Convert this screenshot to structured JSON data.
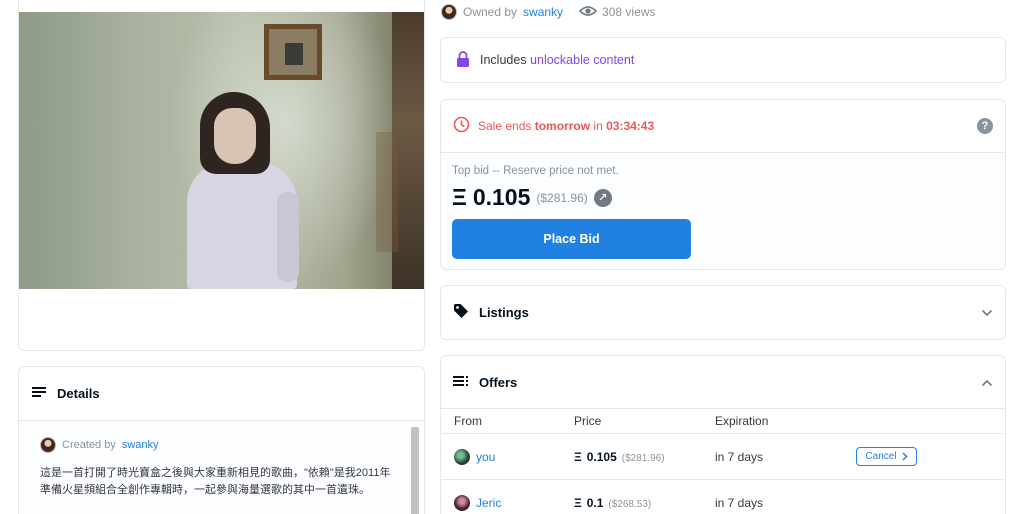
{
  "owner": {
    "prefix": "Owned by",
    "name": "swanky",
    "views": "308 views"
  },
  "unlockable": {
    "prefix": "Includes",
    "link": "unlockable content"
  },
  "sale": {
    "prefix": "Sale ends",
    "when": "tomorrow",
    "mid": "in",
    "countdown": "03:34:43",
    "help": "?",
    "top_bid_label": "Top bid -- Reserve price not met.",
    "eth_symbol": "Ξ",
    "price": "0.105",
    "price_usd": "($281.96)",
    "place_bid_label": "Place Bid"
  },
  "listings": {
    "title": "Listings"
  },
  "details": {
    "title": "Details",
    "created_prefix": "Created by",
    "creator": "swanky",
    "description": "這是一首打開了時光寶盒之後與大家重新相見的歌曲，\"依賴\"是我2011年準備火星頻組合全創作專輯時，一起參與海量選歌的其中一首遺珠。"
  },
  "offers": {
    "title": "Offers",
    "columns": [
      "From",
      "Price",
      "Expiration"
    ],
    "rows": [
      {
        "from": "you",
        "eth": "Ξ",
        "price": "0.105",
        "usd": "($281.96)",
        "expiration": "in 7 days",
        "action": "Cancel"
      },
      {
        "from": "Jeric",
        "eth": "Ξ",
        "price": "0.1",
        "usd": "($268.53)",
        "expiration": "in 7 days",
        "action": ""
      }
    ]
  },
  "colors": {
    "accent": "#2081e2",
    "alert": "#eb5757",
    "purple": "#8247e5"
  }
}
